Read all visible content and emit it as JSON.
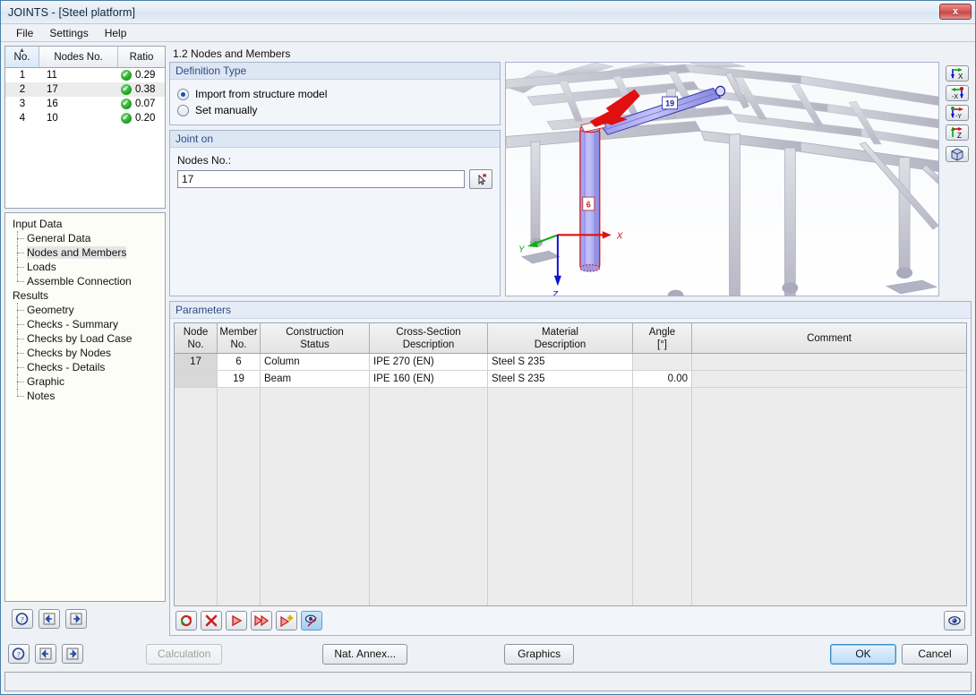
{
  "window": {
    "title": "JOINTS - [Steel platform]",
    "close_label": "x"
  },
  "menu": {
    "items": [
      {
        "label": "File"
      },
      {
        "label": "Settings"
      },
      {
        "label": "Help"
      }
    ]
  },
  "ratio_table": {
    "headers": {
      "no": "No.",
      "nodes": "Nodes No.",
      "ratio": "Ratio"
    },
    "rows": [
      {
        "no": "1",
        "nodes": "11",
        "status": "ok",
        "ratio": "0.29",
        "selected": false
      },
      {
        "no": "2",
        "nodes": "17",
        "status": "ok",
        "ratio": "0.38",
        "selected": true
      },
      {
        "no": "3",
        "nodes": "16",
        "status": "ok",
        "ratio": "0.07",
        "selected": false
      },
      {
        "no": "4",
        "nodes": "10",
        "status": "ok",
        "ratio": "0.20",
        "selected": false
      }
    ]
  },
  "tree": {
    "groups": [
      {
        "label": "Input Data",
        "children": [
          {
            "label": "General Data",
            "active": false
          },
          {
            "label": "Nodes and Members",
            "active": true
          },
          {
            "label": "Loads",
            "active": false
          },
          {
            "label": "Assemble Connection",
            "active": false
          }
        ]
      },
      {
        "label": "Results",
        "children": [
          {
            "label": "Geometry",
            "active": false
          },
          {
            "label": "Checks - Summary",
            "active": false
          },
          {
            "label": "Checks by Load Case",
            "active": false
          },
          {
            "label": "Checks by Nodes",
            "active": false
          },
          {
            "label": "Checks - Details",
            "active": false
          },
          {
            "label": "Graphic",
            "active": false
          },
          {
            "label": "Notes",
            "active": false
          }
        ]
      }
    ]
  },
  "left_toolbar": {
    "help_icon": "help-icon",
    "prev_icon": "previous-icon",
    "next_icon": "next-icon"
  },
  "main": {
    "section_title": "1.2 Nodes and Members",
    "definition_type": {
      "caption": "Definition Type",
      "options": [
        {
          "label": "Import from structure model",
          "selected": true
        },
        {
          "label": "Set manually",
          "selected": false
        }
      ]
    },
    "joint_on": {
      "caption": "Joint on",
      "field_label": "Nodes No.:",
      "value": "17",
      "placeholder": "",
      "pick_icon": "pick-node-icon"
    }
  },
  "viewport": {
    "tools": [
      {
        "name": "view-x-icon",
        "label": "X"
      },
      {
        "name": "view-minus-x-icon",
        "label": "-X"
      },
      {
        "name": "view-minus-y-icon",
        "label": "-Y"
      },
      {
        "name": "view-z-icon",
        "label": "Z"
      },
      {
        "name": "isometric-view-icon",
        "label": ""
      },
      {
        "name": "zoom-reset-icon",
        "label": ""
      }
    ],
    "member_labels": [
      "19",
      "6"
    ],
    "axes": [
      "X",
      "Y",
      "Z"
    ]
  },
  "parameters": {
    "caption": "Parameters",
    "headers": {
      "node_no": {
        "line1": "Node",
        "line2": "No."
      },
      "member_no": {
        "line1": "Member",
        "line2": "No."
      },
      "construction": {
        "line1": "Construction",
        "line2": "Status"
      },
      "cross_section": {
        "line1": "Cross-Section",
        "line2": "Description"
      },
      "material": {
        "line1": "Material",
        "line2": "Description"
      },
      "angle": {
        "line1": "Angle",
        "line2": "[°]"
      },
      "comment": {
        "line1": "Comment",
        "line2": ""
      }
    },
    "rows": [
      {
        "node_no": "17",
        "member_no": "6",
        "construction": "Column",
        "cross_section": "IPE 270 (EN)",
        "material": "Steel S 235",
        "angle": "",
        "comment": ""
      },
      {
        "node_no": "",
        "member_no": "19",
        "construction": "Beam",
        "cross_section": "IPE 160 (EN)",
        "material": "Steel S 235",
        "angle": "0.00",
        "comment": ""
      }
    ],
    "toolbar": [
      {
        "name": "refresh-button",
        "icon": "refresh-icon",
        "selected": false
      },
      {
        "name": "delete-button",
        "icon": "delete-x-icon",
        "selected": false
      },
      {
        "name": "run-button",
        "icon": "play-icon",
        "selected": false
      },
      {
        "name": "run-all-button",
        "icon": "fast-forward-icon",
        "selected": false
      },
      {
        "name": "add-button",
        "icon": "play-plus-icon",
        "selected": false
      },
      {
        "name": "view-toggle-button",
        "icon": "eye-pencil-icon",
        "selected": true
      }
    ],
    "view_button": {
      "name": "visibility-button",
      "icon": "eye-icon"
    }
  },
  "footer": {
    "calculation": "Calculation",
    "nat_annex": "Nat. Annex...",
    "graphics": "Graphics",
    "ok": "OK",
    "cancel": "Cancel"
  }
}
